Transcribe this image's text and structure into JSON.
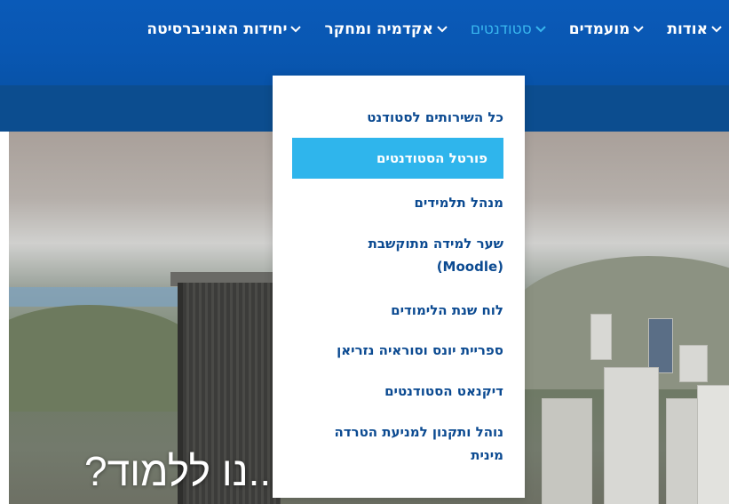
{
  "nav": {
    "items": [
      {
        "label": "אודות"
      },
      {
        "label": "מועמדים"
      },
      {
        "label": "סטודנטים"
      },
      {
        "label": "אקדמיה ומחקר"
      },
      {
        "label": "יחידות האוניברסיטה"
      }
    ],
    "active_index": 2
  },
  "dropdown": {
    "items": [
      {
        "label": "כל השירותים לסטודנט"
      },
      {
        "label": "פורטל הסטודנטים"
      },
      {
        "label": "מנהל תלמידים"
      },
      {
        "label": "שער למידה מתוקשבת (Moodle)"
      },
      {
        "label": "לוח שנת הלימודים"
      },
      {
        "label": "ספריית יונס וסוראיה נזריאן"
      },
      {
        "label": "דיקנאט הסטודנטים"
      },
      {
        "label": "נוהל ותקנון למניעת הטרדה מינית"
      }
    ],
    "highlighted_index": 1
  },
  "hero": {
    "title": "...נו ללמוד?"
  },
  "colors": {
    "nav_bg": "#0957b2",
    "band_bg": "#0c4d8f",
    "active_nav": "#38b6ee",
    "dropdown_text": "#0b4a91",
    "highlight_bg": "#2fb5ec"
  },
  "icons": {
    "nav_chevron": "chevron-down-icon"
  }
}
